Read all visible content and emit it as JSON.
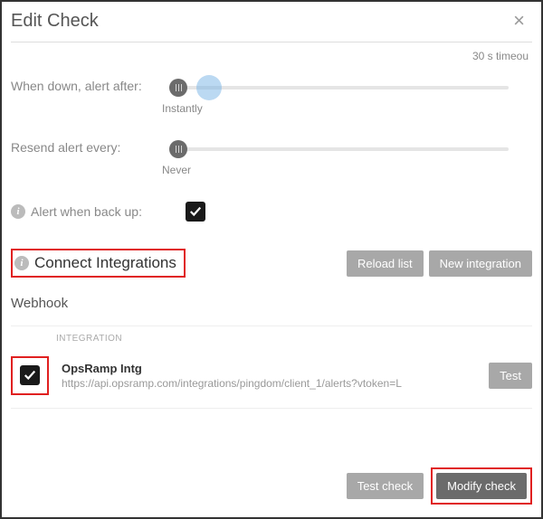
{
  "modal": {
    "title": "Edit Check",
    "close_label": "×"
  },
  "timeout": {
    "text": "30 s timeou"
  },
  "alert_after": {
    "label": "When down, alert after:",
    "value_text": "Instantly"
  },
  "resend": {
    "label": "Resend alert every:",
    "value_text": "Never"
  },
  "alert_backup": {
    "label": "Alert when back up:",
    "checked": true
  },
  "integrations": {
    "title": "Connect Integrations",
    "reload_btn": "Reload list",
    "new_btn": "New integration",
    "subsection": "Webhook",
    "col_header": "INTEGRATION",
    "item": {
      "name": "OpsRamp Intg",
      "url": "https://api.opsramp.com/integrations/pingdom/client_1/alerts?vtoken=L",
      "test_btn": "Test"
    }
  },
  "footer": {
    "test_check": "Test check",
    "modify_check": "Modify check"
  }
}
